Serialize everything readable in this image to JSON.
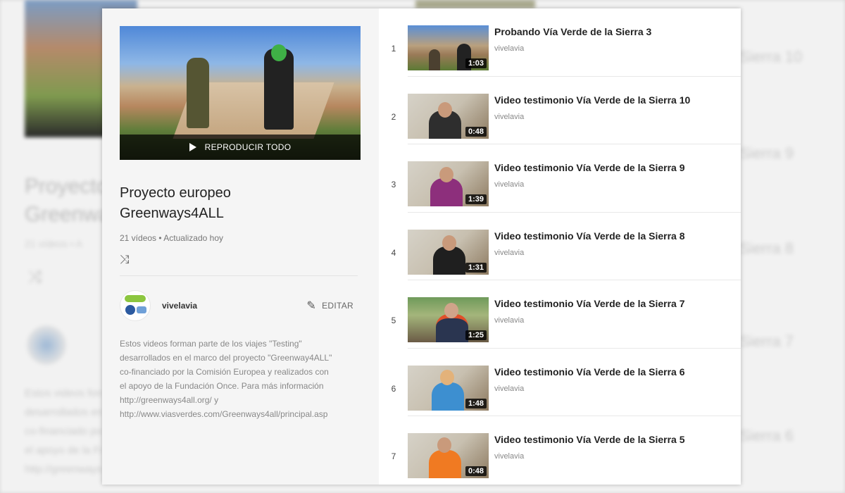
{
  "playlist": {
    "play_all_label": "REPRODUCIR TODO",
    "title_line1": "Proyecto europeo",
    "title_line2": "Greenways4ALL",
    "video_count": "21 vídeos",
    "meta_sep": "•",
    "updated": "Actualizado hoy",
    "owner": "vivelavia",
    "edit_label": "EDITAR",
    "description": [
      "Estos videos forman parte de los viajes \"Testing\"",
      "desarrollados en el marco del proyecto \"Greenway4ALL\"",
      "co-financiado por la Comisión Europea y realizados con",
      "el apoyo de la Fundación Once. Para más  información",
      "http://greenways4all.org/ y",
      "http://www.viasverdes.com/Greenways4all/principal.asp"
    ]
  },
  "videos": [
    {
      "index": "1",
      "title": "Probando Vía Verde de la Sierra 3",
      "channel": "vivelavia",
      "duration": "1:03",
      "scene": "bike"
    },
    {
      "index": "2",
      "title": "Video testimonio Vía Verde de la Sierra 10",
      "channel": "vivelavia",
      "duration": "0:48",
      "scene": "room"
    },
    {
      "index": "3",
      "title": "Video testimonio Vía Verde de la Sierra 9",
      "channel": "vivelavia",
      "duration": "1:39",
      "scene": "room"
    },
    {
      "index": "4",
      "title": "Video testimonio Vía Verde de la Sierra 8",
      "channel": "vivelavia",
      "duration": "1:31",
      "scene": "room"
    },
    {
      "index": "5",
      "title": "Video testimonio Vía Verde de la Sierra 7",
      "channel": "vivelavia",
      "duration": "1:25",
      "scene": "out"
    },
    {
      "index": "6",
      "title": "Video testimonio Vía Verde de la Sierra 6",
      "channel": "vivelavia",
      "duration": "1:48",
      "scene": "room"
    },
    {
      "index": "7",
      "title": "Video testimonio Vía Verde de la Sierra 5",
      "channel": "vivelavia",
      "duration": "0:48",
      "scene": "room"
    }
  ],
  "background": {
    "title_partial": "Proyecto",
    "title_partial2": "Greenways",
    "meta_partial": "21 vídeos • A",
    "right_titles": [
      "Sierra 10",
      "Sierra 9",
      "Sierra 8",
      "Sierra 7",
      "Sierra 6"
    ]
  },
  "colors": {
    "card_bg": "#ffffff",
    "left_panel_bg": "#f5f5f5",
    "title_text": "#222222",
    "meta_text": "#777777"
  },
  "icons": {
    "play": "play-icon",
    "shuffle": "shuffle-icon",
    "edit": "pencil-icon"
  }
}
